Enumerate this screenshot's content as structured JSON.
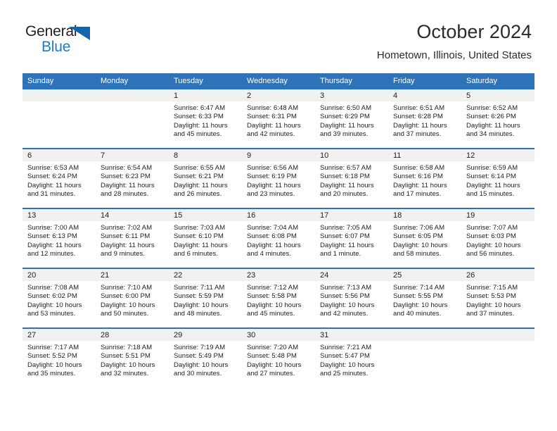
{
  "brand": {
    "name_part1": "General",
    "name_part2": "Blue",
    "triangle_color": "#1565a8",
    "blue_color": "#1f7bc1"
  },
  "header": {
    "title": "October 2024",
    "subtitle": "Hometown, Illinois, United States"
  },
  "theme": {
    "header_blue": "#2e73b8",
    "daynum_band": "#f1f1f1",
    "text": "#222222"
  },
  "calendar": {
    "weekday_headers": [
      "Sunday",
      "Monday",
      "Tuesday",
      "Wednesday",
      "Thursday",
      "Friday",
      "Saturday"
    ],
    "weeks": [
      [
        {
          "day": "",
          "sunrise": "",
          "sunset": "",
          "daylight_line1": "",
          "daylight_line2": ""
        },
        {
          "day": "",
          "sunrise": "",
          "sunset": "",
          "daylight_line1": "",
          "daylight_line2": ""
        },
        {
          "day": "1",
          "sunrise": "Sunrise: 6:47 AM",
          "sunset": "Sunset: 6:33 PM",
          "daylight_line1": "Daylight: 11 hours",
          "daylight_line2": "and 45 minutes."
        },
        {
          "day": "2",
          "sunrise": "Sunrise: 6:48 AM",
          "sunset": "Sunset: 6:31 PM",
          "daylight_line1": "Daylight: 11 hours",
          "daylight_line2": "and 42 minutes."
        },
        {
          "day": "3",
          "sunrise": "Sunrise: 6:50 AM",
          "sunset": "Sunset: 6:29 PM",
          "daylight_line1": "Daylight: 11 hours",
          "daylight_line2": "and 39 minutes."
        },
        {
          "day": "4",
          "sunrise": "Sunrise: 6:51 AM",
          "sunset": "Sunset: 6:28 PM",
          "daylight_line1": "Daylight: 11 hours",
          "daylight_line2": "and 37 minutes."
        },
        {
          "day": "5",
          "sunrise": "Sunrise: 6:52 AM",
          "sunset": "Sunset: 6:26 PM",
          "daylight_line1": "Daylight: 11 hours",
          "daylight_line2": "and 34 minutes."
        }
      ],
      [
        {
          "day": "6",
          "sunrise": "Sunrise: 6:53 AM",
          "sunset": "Sunset: 6:24 PM",
          "daylight_line1": "Daylight: 11 hours",
          "daylight_line2": "and 31 minutes."
        },
        {
          "day": "7",
          "sunrise": "Sunrise: 6:54 AM",
          "sunset": "Sunset: 6:23 PM",
          "daylight_line1": "Daylight: 11 hours",
          "daylight_line2": "and 28 minutes."
        },
        {
          "day": "8",
          "sunrise": "Sunrise: 6:55 AM",
          "sunset": "Sunset: 6:21 PM",
          "daylight_line1": "Daylight: 11 hours",
          "daylight_line2": "and 26 minutes."
        },
        {
          "day": "9",
          "sunrise": "Sunrise: 6:56 AM",
          "sunset": "Sunset: 6:19 PM",
          "daylight_line1": "Daylight: 11 hours",
          "daylight_line2": "and 23 minutes."
        },
        {
          "day": "10",
          "sunrise": "Sunrise: 6:57 AM",
          "sunset": "Sunset: 6:18 PM",
          "daylight_line1": "Daylight: 11 hours",
          "daylight_line2": "and 20 minutes."
        },
        {
          "day": "11",
          "sunrise": "Sunrise: 6:58 AM",
          "sunset": "Sunset: 6:16 PM",
          "daylight_line1": "Daylight: 11 hours",
          "daylight_line2": "and 17 minutes."
        },
        {
          "day": "12",
          "sunrise": "Sunrise: 6:59 AM",
          "sunset": "Sunset: 6:14 PM",
          "daylight_line1": "Daylight: 11 hours",
          "daylight_line2": "and 15 minutes."
        }
      ],
      [
        {
          "day": "13",
          "sunrise": "Sunrise: 7:00 AM",
          "sunset": "Sunset: 6:13 PM",
          "daylight_line1": "Daylight: 11 hours",
          "daylight_line2": "and 12 minutes."
        },
        {
          "day": "14",
          "sunrise": "Sunrise: 7:02 AM",
          "sunset": "Sunset: 6:11 PM",
          "daylight_line1": "Daylight: 11 hours",
          "daylight_line2": "and 9 minutes."
        },
        {
          "day": "15",
          "sunrise": "Sunrise: 7:03 AM",
          "sunset": "Sunset: 6:10 PM",
          "daylight_line1": "Daylight: 11 hours",
          "daylight_line2": "and 6 minutes."
        },
        {
          "day": "16",
          "sunrise": "Sunrise: 7:04 AM",
          "sunset": "Sunset: 6:08 PM",
          "daylight_line1": "Daylight: 11 hours",
          "daylight_line2": "and 4 minutes."
        },
        {
          "day": "17",
          "sunrise": "Sunrise: 7:05 AM",
          "sunset": "Sunset: 6:07 PM",
          "daylight_line1": "Daylight: 11 hours",
          "daylight_line2": "and 1 minute."
        },
        {
          "day": "18",
          "sunrise": "Sunrise: 7:06 AM",
          "sunset": "Sunset: 6:05 PM",
          "daylight_line1": "Daylight: 10 hours",
          "daylight_line2": "and 58 minutes."
        },
        {
          "day": "19",
          "sunrise": "Sunrise: 7:07 AM",
          "sunset": "Sunset: 6:03 PM",
          "daylight_line1": "Daylight: 10 hours",
          "daylight_line2": "and 56 minutes."
        }
      ],
      [
        {
          "day": "20",
          "sunrise": "Sunrise: 7:08 AM",
          "sunset": "Sunset: 6:02 PM",
          "daylight_line1": "Daylight: 10 hours",
          "daylight_line2": "and 53 minutes."
        },
        {
          "day": "21",
          "sunrise": "Sunrise: 7:10 AM",
          "sunset": "Sunset: 6:00 PM",
          "daylight_line1": "Daylight: 10 hours",
          "daylight_line2": "and 50 minutes."
        },
        {
          "day": "22",
          "sunrise": "Sunrise: 7:11 AM",
          "sunset": "Sunset: 5:59 PM",
          "daylight_line1": "Daylight: 10 hours",
          "daylight_line2": "and 48 minutes."
        },
        {
          "day": "23",
          "sunrise": "Sunrise: 7:12 AM",
          "sunset": "Sunset: 5:58 PM",
          "daylight_line1": "Daylight: 10 hours",
          "daylight_line2": "and 45 minutes."
        },
        {
          "day": "24",
          "sunrise": "Sunrise: 7:13 AM",
          "sunset": "Sunset: 5:56 PM",
          "daylight_line1": "Daylight: 10 hours",
          "daylight_line2": "and 42 minutes."
        },
        {
          "day": "25",
          "sunrise": "Sunrise: 7:14 AM",
          "sunset": "Sunset: 5:55 PM",
          "daylight_line1": "Daylight: 10 hours",
          "daylight_line2": "and 40 minutes."
        },
        {
          "day": "26",
          "sunrise": "Sunrise: 7:15 AM",
          "sunset": "Sunset: 5:53 PM",
          "daylight_line1": "Daylight: 10 hours",
          "daylight_line2": "and 37 minutes."
        }
      ],
      [
        {
          "day": "27",
          "sunrise": "Sunrise: 7:17 AM",
          "sunset": "Sunset: 5:52 PM",
          "daylight_line1": "Daylight: 10 hours",
          "daylight_line2": "and 35 minutes."
        },
        {
          "day": "28",
          "sunrise": "Sunrise: 7:18 AM",
          "sunset": "Sunset: 5:51 PM",
          "daylight_line1": "Daylight: 10 hours",
          "daylight_line2": "and 32 minutes."
        },
        {
          "day": "29",
          "sunrise": "Sunrise: 7:19 AM",
          "sunset": "Sunset: 5:49 PM",
          "daylight_line1": "Daylight: 10 hours",
          "daylight_line2": "and 30 minutes."
        },
        {
          "day": "30",
          "sunrise": "Sunrise: 7:20 AM",
          "sunset": "Sunset: 5:48 PM",
          "daylight_line1": "Daylight: 10 hours",
          "daylight_line2": "and 27 minutes."
        },
        {
          "day": "31",
          "sunrise": "Sunrise: 7:21 AM",
          "sunset": "Sunset: 5:47 PM",
          "daylight_line1": "Daylight: 10 hours",
          "daylight_line2": "and 25 minutes."
        },
        {
          "day": "",
          "sunrise": "",
          "sunset": "",
          "daylight_line1": "",
          "daylight_line2": ""
        },
        {
          "day": "",
          "sunrise": "",
          "sunset": "",
          "daylight_line1": "",
          "daylight_line2": ""
        }
      ]
    ]
  }
}
